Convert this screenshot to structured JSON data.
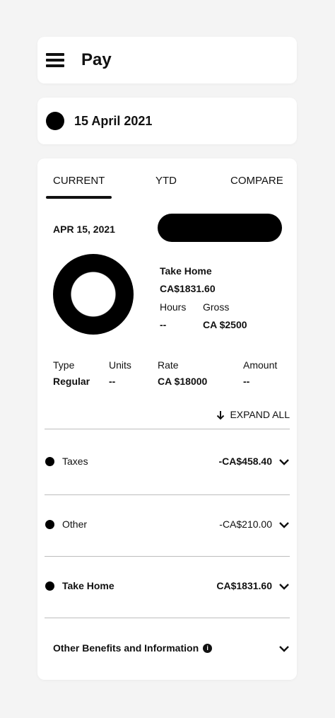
{
  "header": {
    "title": "Pay"
  },
  "date_selector": {
    "date": "15 April 2021"
  },
  "tabs": [
    {
      "label": "CURRENT",
      "active": true
    },
    {
      "label": "YTD",
      "active": false
    },
    {
      "label": "COMPARE",
      "active": false
    }
  ],
  "summary": {
    "pay_date": "APR 15, 2021",
    "take_home_label": "Take Home",
    "take_home_value": "CA$1831.60",
    "hours_label": "Hours",
    "hours_value": "--",
    "gross_label": "Gross",
    "gross_value": "CA $2500"
  },
  "earnings": {
    "headers": [
      "Type",
      "Units",
      "Rate",
      "Amount"
    ],
    "row": {
      "type": "Regular",
      "units": "--",
      "rate": "CA $18000",
      "amount": "--"
    }
  },
  "expand_all_label": "EXPAND ALL",
  "sections": [
    {
      "label": "Taxes",
      "amount": "-CA$458.40"
    },
    {
      "label": "Other",
      "amount": "-CA$210.00"
    },
    {
      "label": "Take Home",
      "amount": "CA$1831.60"
    }
  ],
  "benefits": {
    "label": "Other Benefits and Information",
    "info_icon": "i"
  },
  "colors": {
    "background": "#f4f4f4",
    "card": "#ffffff",
    "text": "#111111",
    "divider": "#bdbdbd"
  },
  "icons": [
    "menu-icon",
    "circle-icon",
    "arrow-down-icon",
    "chevron-down-icon",
    "info-icon"
  ]
}
